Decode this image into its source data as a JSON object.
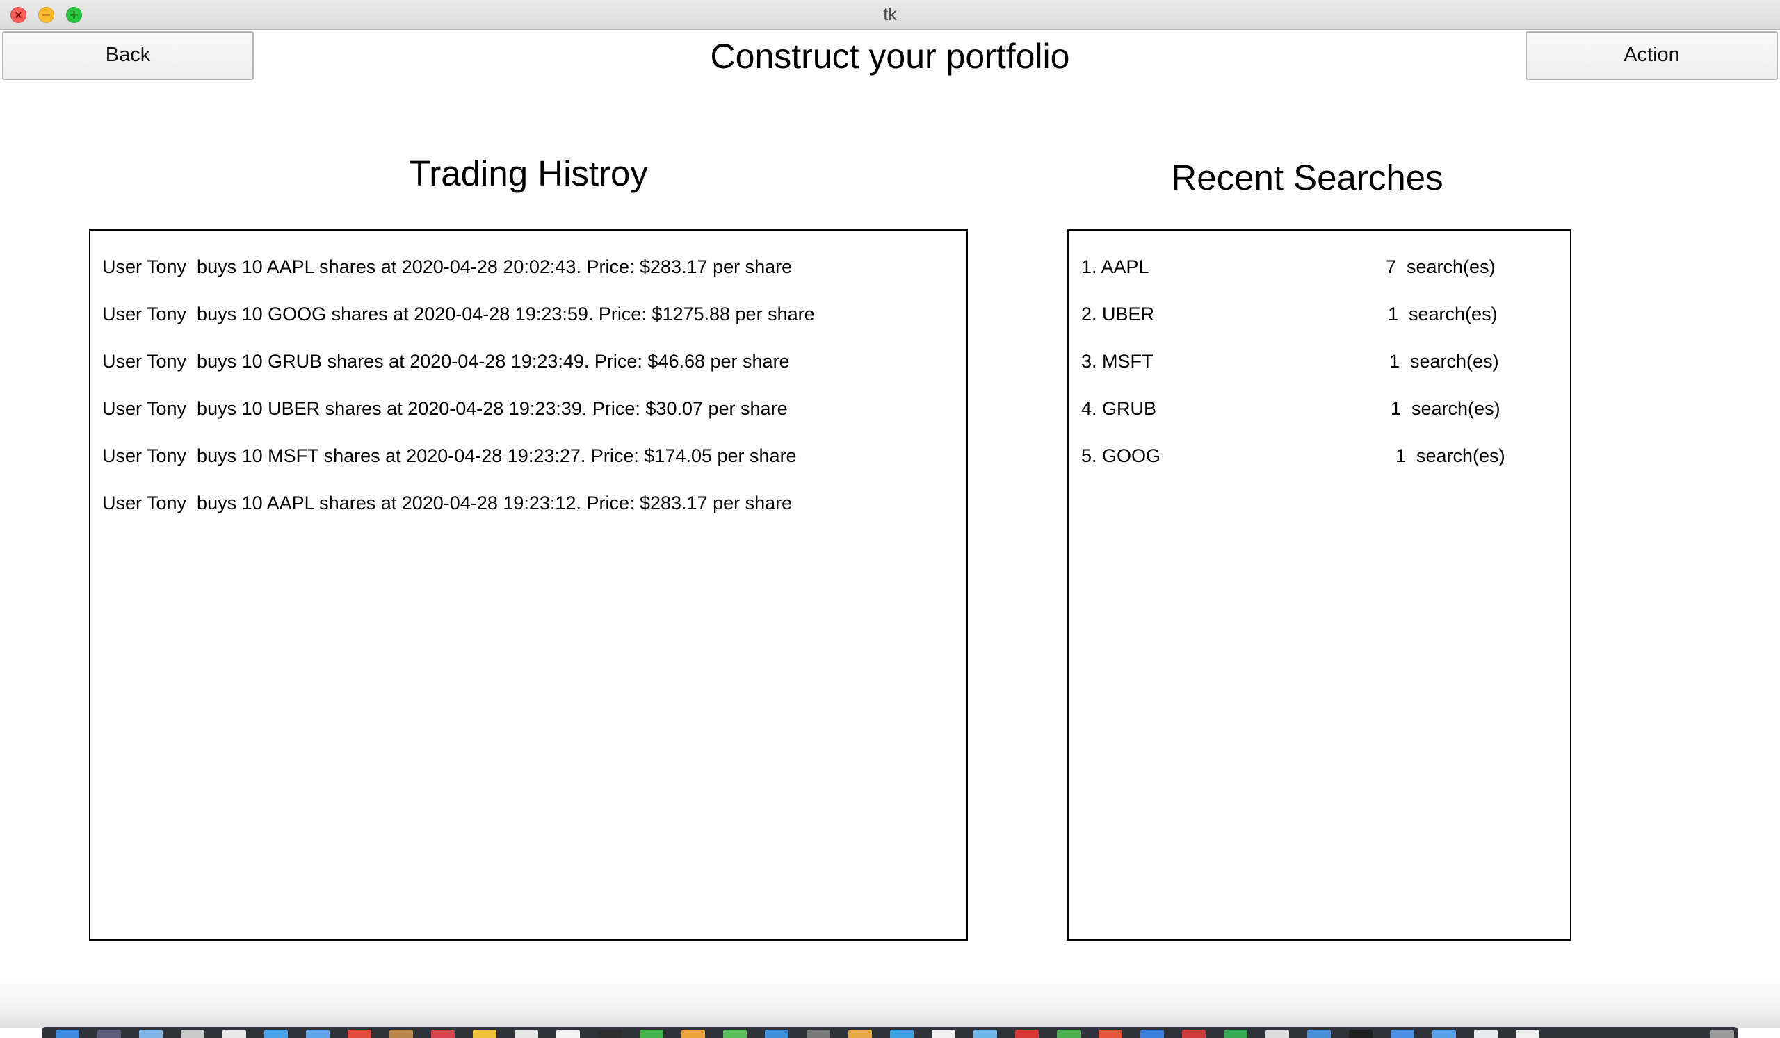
{
  "window": {
    "title": "tk"
  },
  "header": {
    "back_label": "Back",
    "title": "Construct your portfolio",
    "action_label": "Action"
  },
  "trading_history": {
    "heading": "Trading Histroy",
    "entries": [
      "User Tony  buys 10 AAPL shares at 2020-04-28 20:02:43. Price: $283.17 per share",
      "User Tony  buys 10 GOOG shares at 2020-04-28 19:23:59. Price: $1275.88 per share",
      "User Tony  buys 10 GRUB shares at 2020-04-28 19:23:49. Price: $46.68 per share",
      "User Tony  buys 10 UBER shares at 2020-04-28 19:23:39. Price: $30.07 per share",
      "User Tony  buys 10 MSFT shares at 2020-04-28 19:23:27. Price: $174.05 per share",
      "User Tony  buys 10 AAPL shares at 2020-04-28 19:23:12. Price: $283.17 per share"
    ]
  },
  "recent_searches": {
    "heading": "Recent Searches",
    "items": [
      {
        "rank": "1. AAPL",
        "count": "7  search(es)"
      },
      {
        "rank": "2. UBER",
        "count": "1  search(es)"
      },
      {
        "rank": "3. MSFT",
        "count": "1  search(es)"
      },
      {
        "rank": "4. GRUB",
        "count": "1  search(es)"
      },
      {
        "rank": "5. GOOG",
        "count": "1  search(es)"
      }
    ]
  },
  "colors": {
    "close": "#fc5f57",
    "minimize": "#fdbc2e",
    "maximize": "#28c840",
    "dock": "#2f3238"
  }
}
